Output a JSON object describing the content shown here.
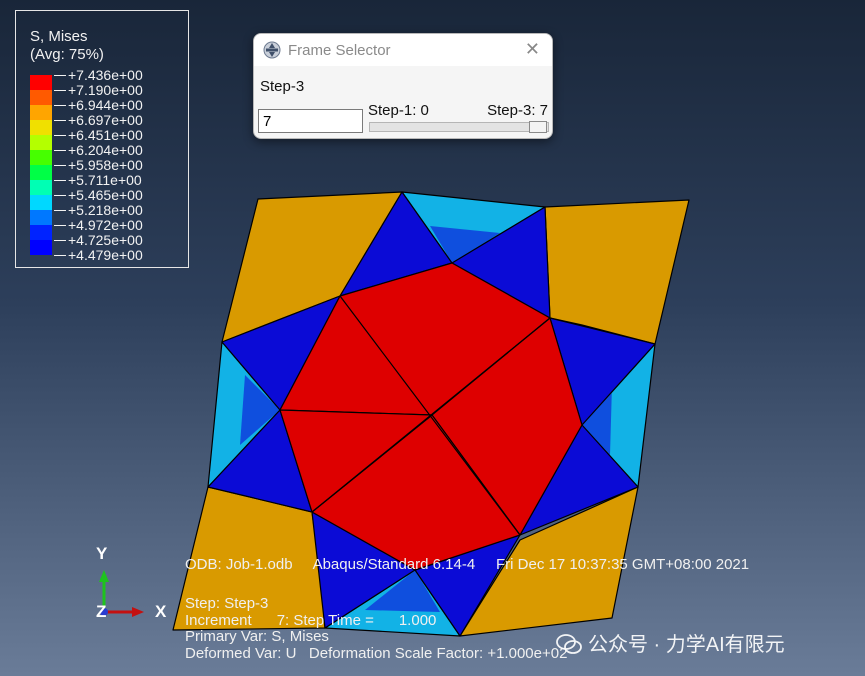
{
  "legend": {
    "title_line1": "S, Mises",
    "title_line2": "(Avg: 75%)",
    "values": [
      "+7.436e+00",
      "+7.190e+00",
      "+6.944e+00",
      "+6.697e+00",
      "+6.451e+00",
      "+6.204e+00",
      "+5.958e+00",
      "+5.711e+00",
      "+5.465e+00",
      "+5.218e+00",
      "+4.972e+00",
      "+4.725e+00",
      "+4.479e+00"
    ],
    "band_colors": [
      "#ff0000",
      "#ff5a00",
      "#ffa500",
      "#f0e000",
      "#b4ff00",
      "#46ff00",
      "#00ff46",
      "#00ffb4",
      "#00d8ff",
      "#0078ff",
      "#0023ff",
      "#0000ff"
    ]
  },
  "frame_selector": {
    "title": "Frame Selector",
    "close_glyph": "✕",
    "step_label": "Step-3",
    "frame_value": "7",
    "slider_min_label": "Step-1: 0",
    "slider_max_label": "Step-3: 7",
    "slider_fraction": 1.0
  },
  "triad": {
    "y": "Y",
    "x": "X",
    "z": "Z"
  },
  "info": {
    "odb_line": "ODB: Job-1.odb     Abaqus/Standard 6.14-4     Fri Dec 17 10:37:35 GMT+08:00 2021",
    "step_line": "Step: Step-3",
    "increment_line": "Increment      7: Step Time =      1.000",
    "primary_line": "Primary Var: S, Mises",
    "deformed_line": "Deformed Var: U   Deformation Scale Factor: +1.000e+02"
  },
  "watermark": {
    "text": "公众号 · 力学AI有限元"
  },
  "colors": {
    "orange": "#d99a00",
    "red": "#de0000",
    "blue": "#0b0bd6",
    "mid_blue": "#0f4fde",
    "cyan": "#0ea0da",
    "light_cyan": "#12b9e6",
    "edge": "#000000"
  }
}
